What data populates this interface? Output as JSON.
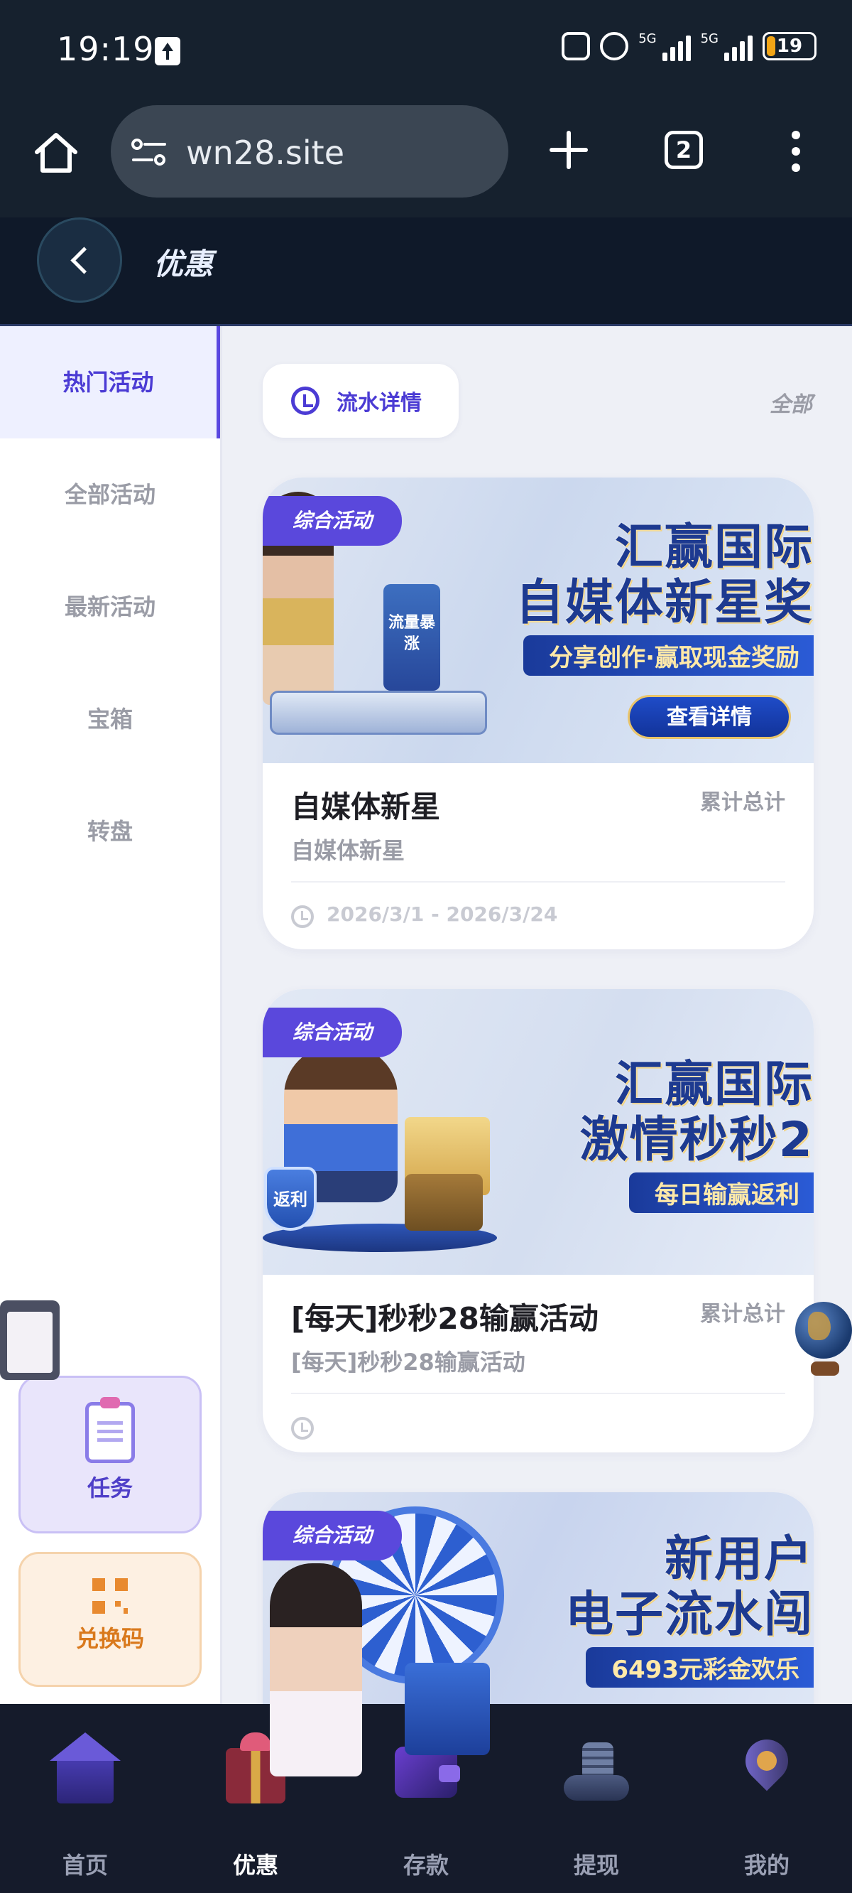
{
  "status_bar": {
    "time": "19:19",
    "network_1": "5G",
    "network_2": "5G",
    "battery": "19",
    "battery_color": "#f2a516"
  },
  "browser": {
    "url": "wn28.site",
    "tab_count": "2"
  },
  "header": {
    "title": "优惠"
  },
  "sidebar": {
    "items": [
      {
        "label": "热门活动",
        "active": true
      },
      {
        "label": "全部活动",
        "active": false
      },
      {
        "label": "最新活动",
        "active": false
      },
      {
        "label": "宝箱",
        "active": false
      },
      {
        "label": "转盘",
        "active": false
      }
    ],
    "task_label": "任务",
    "code_label": "兑换码"
  },
  "toolbar": {
    "flow_label": "流水详情",
    "all_label": "全部"
  },
  "cards": [
    {
      "tag": "综合活动",
      "banner_line1": "汇赢国际",
      "banner_line2": "自媒体新星奖",
      "banner_strip": "分享创作·赢取现金奖励",
      "banner_button": "查看详情",
      "banner_side_text": "流量暴涨",
      "title": "自媒体新星",
      "total": "累计总计",
      "subtitle": "自媒体新星",
      "date": "2026/3/1 - 2026/3/24"
    },
    {
      "tag": "综合活动",
      "banner_line1": "汇赢国际",
      "banner_line2": "激情秒秒2",
      "banner_strip": "每日输赢返利",
      "banner_side_text": "返利",
      "title": "[每天]秒秒28输赢活动",
      "total": "累计总计",
      "subtitle": "[每天]秒秒28输赢活动",
      "date": ""
    },
    {
      "tag": "综合活动",
      "banner_line1": "新用户",
      "banner_line2": "电子流水闯",
      "banner_strip": "6493元彩金欢乐"
    }
  ],
  "bottom_nav": [
    {
      "label": "首页",
      "icon": "home-icon",
      "active": false
    },
    {
      "label": "优惠",
      "icon": "gift-icon",
      "active": true
    },
    {
      "label": "存款",
      "icon": "wallet-icon",
      "active": false
    },
    {
      "label": "提现",
      "icon": "withdraw-icon",
      "active": false
    },
    {
      "label": "我的",
      "icon": "profile-icon",
      "active": false
    }
  ],
  "colors": {
    "accent": "#4b3bd4",
    "tag_bg": "#5a48dc",
    "nav_bg": "#151b2b",
    "header_bg": "#0f1929"
  }
}
